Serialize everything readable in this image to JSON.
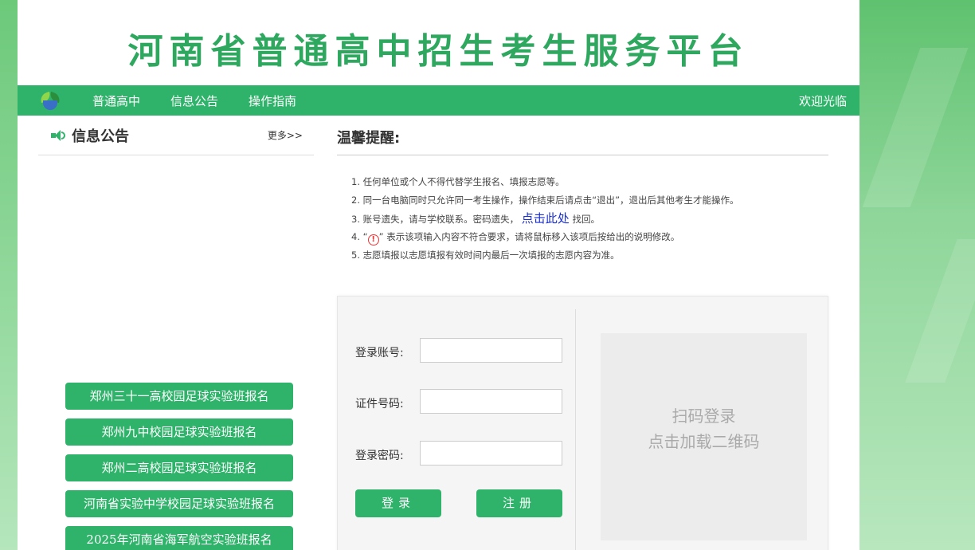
{
  "site": {
    "title": "河南省普通高中招生考生服务平台"
  },
  "nav": {
    "items": [
      "普通高中",
      "信息公告",
      "操作指南"
    ],
    "welcome": "欢迎光临"
  },
  "notice": {
    "title": "信息公告",
    "more": "更多>>"
  },
  "links": [
    "郑州三十一高校园足球实验班报名",
    "郑州九中校园足球实验班报名",
    "郑州二高校园足球实验班报名",
    "河南省实验中学校园足球实验班报名",
    "2025年河南省海军航空实验班报名"
  ],
  "tips": {
    "title": "温馨提醒:",
    "items": {
      "t1": "1. 任何单位或个人不得代替学生报名、填报志愿等。",
      "t2": "2. 同一台电脑同时只允许同一考生操作，操作结束后请点击“退出”，退出后其他考生才能操作。",
      "t3a": "3. 账号遗失，请与学校联系。密码遗失，",
      "t3link": "点击此处",
      "t3b": "找回。",
      "t4a": "4. “",
      "t4icon": "!",
      "t4b": "” 表示该项输入内容不符合要求，请将鼠标移入该项后按给出的说明修改。",
      "t5": "5. 志愿填报以志愿填报有效时间内最后一次填报的志愿内容为准。"
    }
  },
  "login": {
    "account_label": "登录账号:",
    "account_value": "",
    "id_label": "证件号码:",
    "id_value": "",
    "password_label": "登录密码:",
    "password_value": "",
    "login_button": "登录",
    "register_button": "注册",
    "qr_line1": "扫码登录",
    "qr_line2": "点击加载二维码"
  },
  "colors": {
    "brand": "#2fb36a",
    "title": "#2fa85f",
    "link": "#1a2fd0",
    "warn": "#ee3333"
  }
}
